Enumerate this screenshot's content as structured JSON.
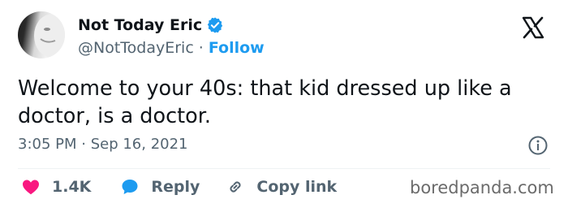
{
  "author": {
    "display_name": "Not Today Eric",
    "handle": "@NotTodayEric",
    "separator": "·",
    "follow_label": "Follow"
  },
  "tweet": {
    "text": "Welcome to your 40s: that kid dressed up like a doctor, is a doctor.",
    "timestamp": "3:05 PM · Sep 16, 2021"
  },
  "actions": {
    "like_count": "1.4K",
    "reply_label": "Reply",
    "copy_link_label": "Copy link"
  },
  "watermark": "boredpanda.com",
  "icons": {
    "verified": "verified-badge-icon",
    "platform": "x-logo-icon",
    "info": "info-icon",
    "like": "heart-icon",
    "reply": "speech-bubble-icon",
    "copy_link": "link-icon"
  },
  "colors": {
    "accent": "#1d9bf0",
    "like": "#f91880",
    "text": "#0f1419",
    "secondary": "#536471"
  }
}
